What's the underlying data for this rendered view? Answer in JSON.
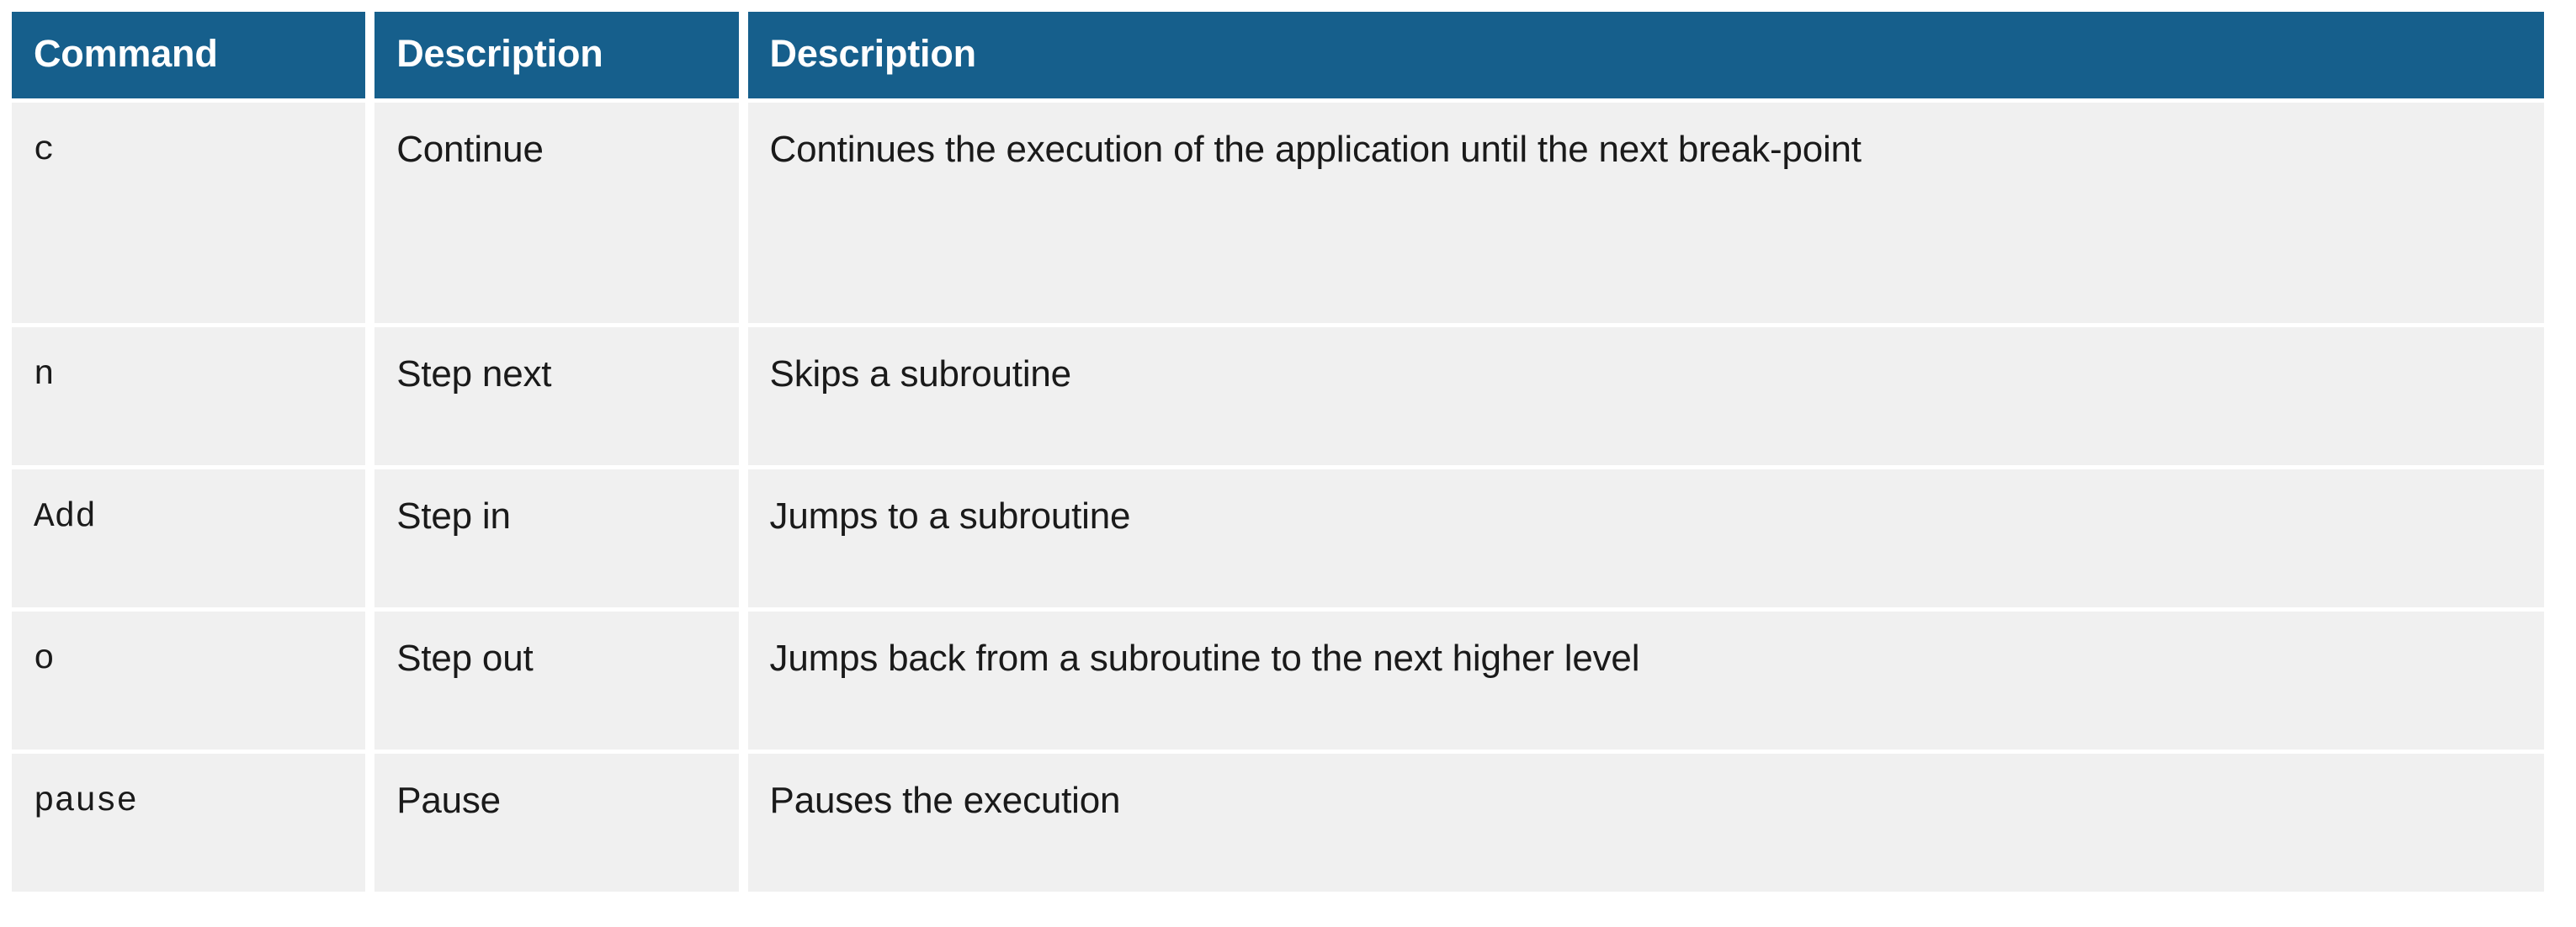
{
  "table": {
    "columns": [
      {
        "key": "command",
        "label": "Command"
      },
      {
        "key": "description_short",
        "label": "Description"
      },
      {
        "key": "description_long",
        "label": "Description"
      }
    ],
    "rows": [
      {
        "command": "c",
        "description_short": "Continue",
        "description_long": "Continues the execution of the application until the next break-point"
      },
      {
        "command": "n",
        "description_short": "Step next",
        "description_long": "Skips a subroutine"
      },
      {
        "command": "Add",
        "description_short": "Step in",
        "description_long": "Jumps to a subroutine"
      },
      {
        "command": "o",
        "description_short": "Step out",
        "description_long": "Jumps back from a subroutine to the next higher level"
      },
      {
        "command": "pause",
        "description_short": "Pause",
        "description_long": "Pauses the execution"
      }
    ]
  },
  "colors": {
    "header_background": "#165F8C",
    "header_text": "#FFFFFF",
    "cell_background": "#F0F0F0",
    "cell_text": "#1A1A1A",
    "page_background": "#FFFFFF"
  }
}
